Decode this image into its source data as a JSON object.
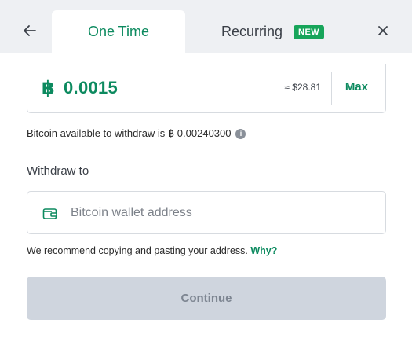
{
  "tabs": {
    "one_time": "One Time",
    "recurring": "Recurring",
    "new_badge": "NEW"
  },
  "icons": {
    "back": "arrow-left-icon",
    "close": "close-icon",
    "info": "info-icon",
    "wallet": "wallet-icon"
  },
  "amount": {
    "currency_symbol": "฿",
    "value": "0.0015",
    "usd_estimate": "≈ $28.81",
    "max_label": "Max"
  },
  "available": {
    "text": "Bitcoin available to withdraw is ฿ 0.00240300",
    "info_glyph": "i"
  },
  "withdraw": {
    "label": "Withdraw to",
    "address_value": "",
    "address_placeholder": "Bitcoin wallet address"
  },
  "recommend": {
    "text": "We recommend copying and pasting your address.",
    "why_link": "Why?"
  },
  "continue_label": "Continue",
  "colors": {
    "accent": "#0c8a5f",
    "badge": "#17a55a",
    "disabled_button": "#cfd5de",
    "tab_bar": "#eef0f3"
  }
}
